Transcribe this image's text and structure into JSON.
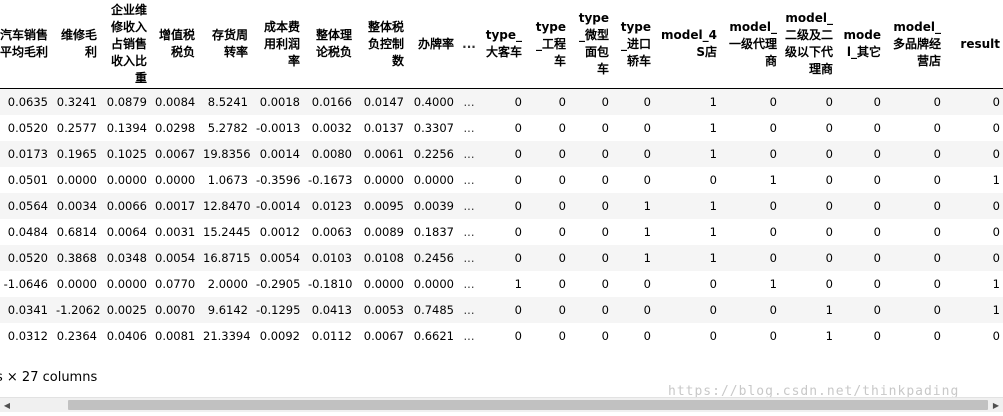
{
  "table": {
    "columns": [
      "汽车销售平均毛利",
      "维修毛利",
      "企业维修收入占销售收入比重",
      "增值税税负",
      "存货周转率",
      "成本费用利润率",
      "整体理论税负",
      "整体税负控制数",
      "办牌率",
      "...",
      "type_大客车",
      "type_工程车",
      "type_微型面包车",
      "type_进口轿车",
      "model_4S店",
      "model_一级代理商",
      "model_二级及二级以下代理商",
      "model_其它",
      "model_多品牌经营店",
      "result"
    ],
    "rows": [
      [
        "0.0635",
        "0.3241",
        "0.0879",
        "0.0084",
        "8.5241",
        "0.0018",
        "0.0166",
        "0.0147",
        "0.4000",
        "...",
        "0",
        "0",
        "0",
        "0",
        "1",
        "0",
        "0",
        "0",
        "0",
        "0"
      ],
      [
        "0.0520",
        "0.2577",
        "0.1394",
        "0.0298",
        "5.2782",
        "-0.0013",
        "0.0032",
        "0.0137",
        "0.3307",
        "...",
        "0",
        "0",
        "0",
        "0",
        "1",
        "0",
        "0",
        "0",
        "0",
        "0"
      ],
      [
        "0.0173",
        "0.1965",
        "0.1025",
        "0.0067",
        "19.8356",
        "0.0014",
        "0.0080",
        "0.0061",
        "0.2256",
        "...",
        "0",
        "0",
        "0",
        "0",
        "1",
        "0",
        "0",
        "0",
        "0",
        "0"
      ],
      [
        "0.0501",
        "0.0000",
        "0.0000",
        "0.0000",
        "1.0673",
        "-0.3596",
        "-0.1673",
        "0.0000",
        "0.0000",
        "...",
        "0",
        "0",
        "0",
        "0",
        "0",
        "1",
        "0",
        "0",
        "0",
        "1"
      ],
      [
        "0.0564",
        "0.0034",
        "0.0066",
        "0.0017",
        "12.8470",
        "-0.0014",
        "0.0123",
        "0.0095",
        "0.0039",
        "...",
        "0",
        "0",
        "0",
        "1",
        "1",
        "0",
        "0",
        "0",
        "0",
        "0"
      ],
      [
        "0.0484",
        "0.6814",
        "0.0064",
        "0.0031",
        "15.2445",
        "0.0012",
        "0.0063",
        "0.0089",
        "0.1837",
        "...",
        "0",
        "0",
        "0",
        "1",
        "1",
        "0",
        "0",
        "0",
        "0",
        "0"
      ],
      [
        "0.0520",
        "0.3868",
        "0.0348",
        "0.0054",
        "16.8715",
        "0.0054",
        "0.0103",
        "0.0108",
        "0.2456",
        "...",
        "0",
        "0",
        "0",
        "1",
        "1",
        "0",
        "0",
        "0",
        "0",
        "0"
      ],
      [
        "-1.0646",
        "0.0000",
        "0.0000",
        "0.0770",
        "2.0000",
        "-0.2905",
        "-0.1810",
        "0.0000",
        "0.0000",
        "...",
        "1",
        "0",
        "0",
        "0",
        "0",
        "1",
        "0",
        "0",
        "0",
        "1"
      ],
      [
        "0.0341",
        "-1.2062",
        "0.0025",
        "0.0070",
        "9.6142",
        "-0.1295",
        "0.0413",
        "0.0053",
        "0.7485",
        "...",
        "0",
        "0",
        "0",
        "0",
        "0",
        "0",
        "1",
        "0",
        "0",
        "1"
      ],
      [
        "0.0312",
        "0.2364",
        "0.0406",
        "0.0081",
        "21.3394",
        "0.0092",
        "0.0112",
        "0.0067",
        "0.6621",
        "...",
        "0",
        "0",
        "0",
        "0",
        "0",
        "0",
        "1",
        "0",
        "0",
        "0"
      ]
    ]
  },
  "footer": {
    "summary": "s × 27 columns"
  },
  "watermark": {
    "text": "https://blog.csdn.net/thinkpading"
  },
  "scrollbar": {
    "left_icon": "triangle-left-icon",
    "right_icon": "triangle-right-icon"
  }
}
